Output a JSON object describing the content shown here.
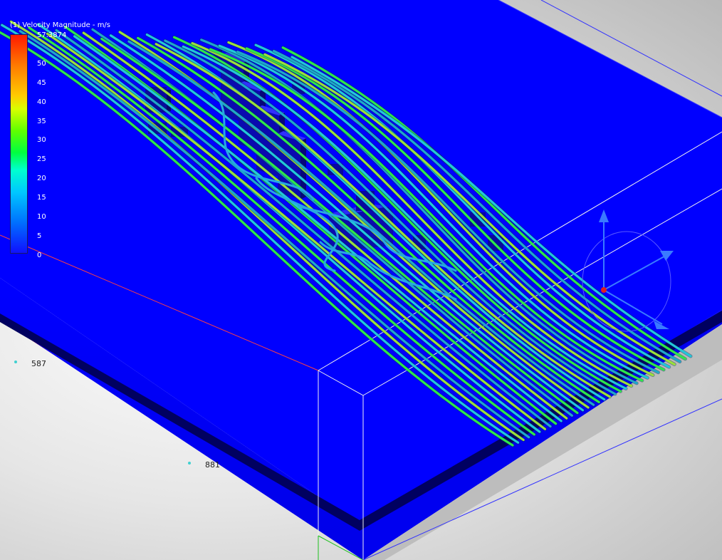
{
  "legend": {
    "title": "(1) Velocity Magnitude - m/s",
    "max": "57.3874",
    "ticks": [
      "50",
      "45",
      "40",
      "35",
      "30",
      "25",
      "20",
      "15",
      "10",
      "5",
      "0"
    ]
  },
  "dimensions": {
    "width": "587",
    "length": "881"
  },
  "colors": {
    "domain_blue": "#0000ff",
    "background_gray": "#c8c8c8",
    "axis_red": "#ff2020",
    "streamline_green": "#2ee64a",
    "streamline_cyan": "#22c8d8"
  },
  "icons": {
    "axis_triad": "view-orientation-triad"
  }
}
